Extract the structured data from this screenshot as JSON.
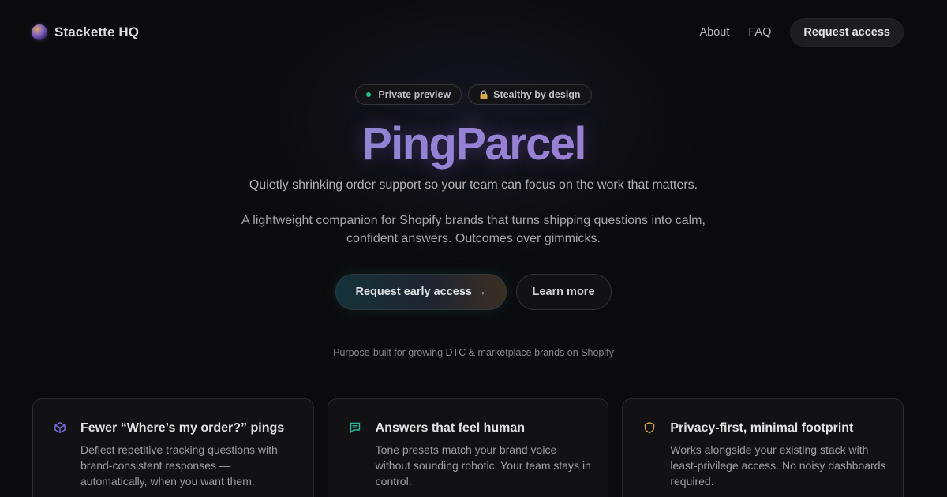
{
  "brand": {
    "name": "Stackette HQ"
  },
  "nav": {
    "links": [
      "About",
      "FAQ"
    ],
    "cta_label": "Request access"
  },
  "pills": [
    {
      "label": "Private preview",
      "icon": "status-dot-green"
    },
    {
      "label": "Stealthy by design",
      "icon": "lock-icon"
    }
  ],
  "hero": {
    "title": "PingParcel",
    "subtitle": "Quietly shrinking order support so your team can focus on the work that matters.",
    "description": "A lightweight companion for Shopify brands that turns shipping questions into calm, confident answers. Outcomes over gimmicks."
  },
  "cta": {
    "primary_label": "Request early access →",
    "secondary_label": "Learn more"
  },
  "divider": {
    "text": "Purpose-built for growing DTC & marketplace brands on Shopify"
  },
  "features": [
    {
      "icon": "cube-icon",
      "icon_color": "#7b6fe0",
      "title": "Fewer “Where’s my order?” pings",
      "text": "Deflect repetitive tracking questions with brand-consistent responses — automatically, when you want them."
    },
    {
      "icon": "chat-icon",
      "icon_color": "#2fb89b",
      "title": "Answers that feel human",
      "text": "Tone presets match your brand voice without sounding robotic. Your team stays in control."
    },
    {
      "icon": "shield-icon",
      "icon_color": "#d8a55a",
      "title": "Privacy-first, minimal footprint",
      "text": "Works alongside your existing stack with least-privilege access. No noisy dashboards required."
    }
  ],
  "colors": {
    "background": "#0b0b0d",
    "status_dot": "#22c08a",
    "title_gradient_start": "#7f8fcc",
    "title_gradient_end": "#a879c7"
  }
}
